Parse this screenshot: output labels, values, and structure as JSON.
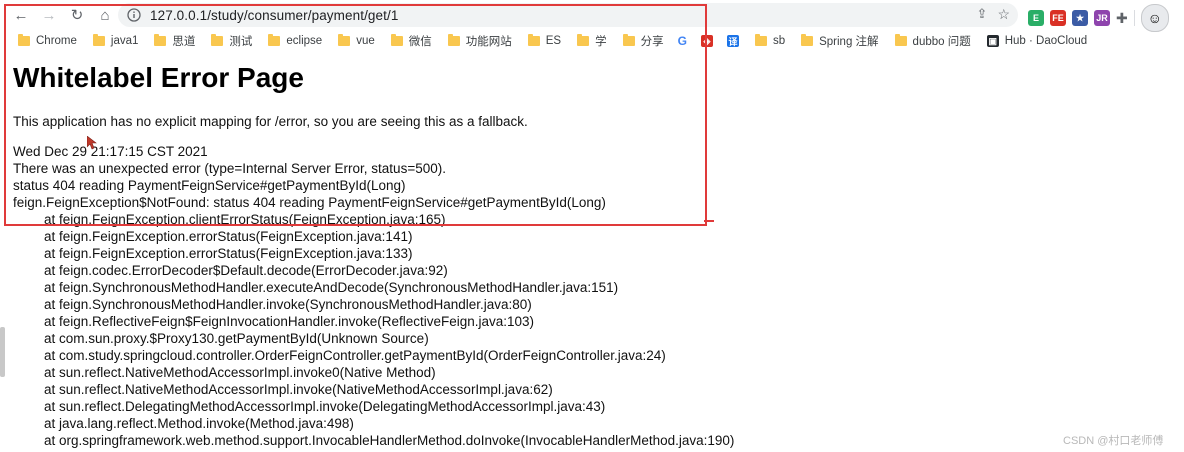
{
  "browser": {
    "url": "127.0.0.1/study/consumer/payment/get/1",
    "bookmarks": [
      "Chrome",
      "java1",
      "思道",
      "测试",
      "eclipse",
      "vue",
      "微信",
      "功能网站",
      "ES",
      "学",
      "分享",
      "sb",
      "Spring 注解",
      "dubbo 问题",
      "Hub · DaoCloud"
    ]
  },
  "page": {
    "title": "Whitelabel Error Page",
    "message": "This application has no explicit mapping for /error, so you are seeing this as a fallback.",
    "timestamp": "Wed Dec 29 21:17:15 CST 2021",
    "error_summary": "There was an unexpected error (type=Internal Server Error, status=500).",
    "status_line": "status 404 reading PaymentFeignService#getPaymentById(Long)",
    "exception": "feign.FeignException$NotFound: status 404 reading PaymentFeignService#getPaymentById(Long)",
    "stack": [
      "at feign.FeignException.clientErrorStatus(FeignException.java:165)",
      "at feign.FeignException.errorStatus(FeignException.java:141)",
      "at feign.FeignException.errorStatus(FeignException.java:133)",
      "at feign.codec.ErrorDecoder$Default.decode(ErrorDecoder.java:92)",
      "at feign.SynchronousMethodHandler.executeAndDecode(SynchronousMethodHandler.java:151)",
      "at feign.SynchronousMethodHandler.invoke(SynchronousMethodHandler.java:80)",
      "at feign.ReflectiveFeign$FeignInvocationHandler.invoke(ReflectiveFeign.java:103)",
      "at com.sun.proxy.$Proxy130.getPaymentById(Unknown Source)",
      "at com.study.springcloud.controller.OrderFeignController.getPaymentById(OrderFeignController.java:24)",
      "at sun.reflect.NativeMethodAccessorImpl.invoke0(Native Method)",
      "at sun.reflect.NativeMethodAccessorImpl.invoke(NativeMethodAccessorImpl.java:62)",
      "at sun.reflect.DelegatingMethodAccessorImpl.invoke(DelegatingMethodAccessorImpl.java:43)",
      "at java.lang.reflect.Method.invoke(Method.java:498)",
      "at org.springframework.web.method.support.InvocableHandlerMethod.doInvoke(InvocableHandlerMethod.java:190)"
    ]
  },
  "watermark": "CSDN @村口老师傅",
  "colors": {
    "highlight": "#e03a3a",
    "folder": "#f9c74f"
  }
}
